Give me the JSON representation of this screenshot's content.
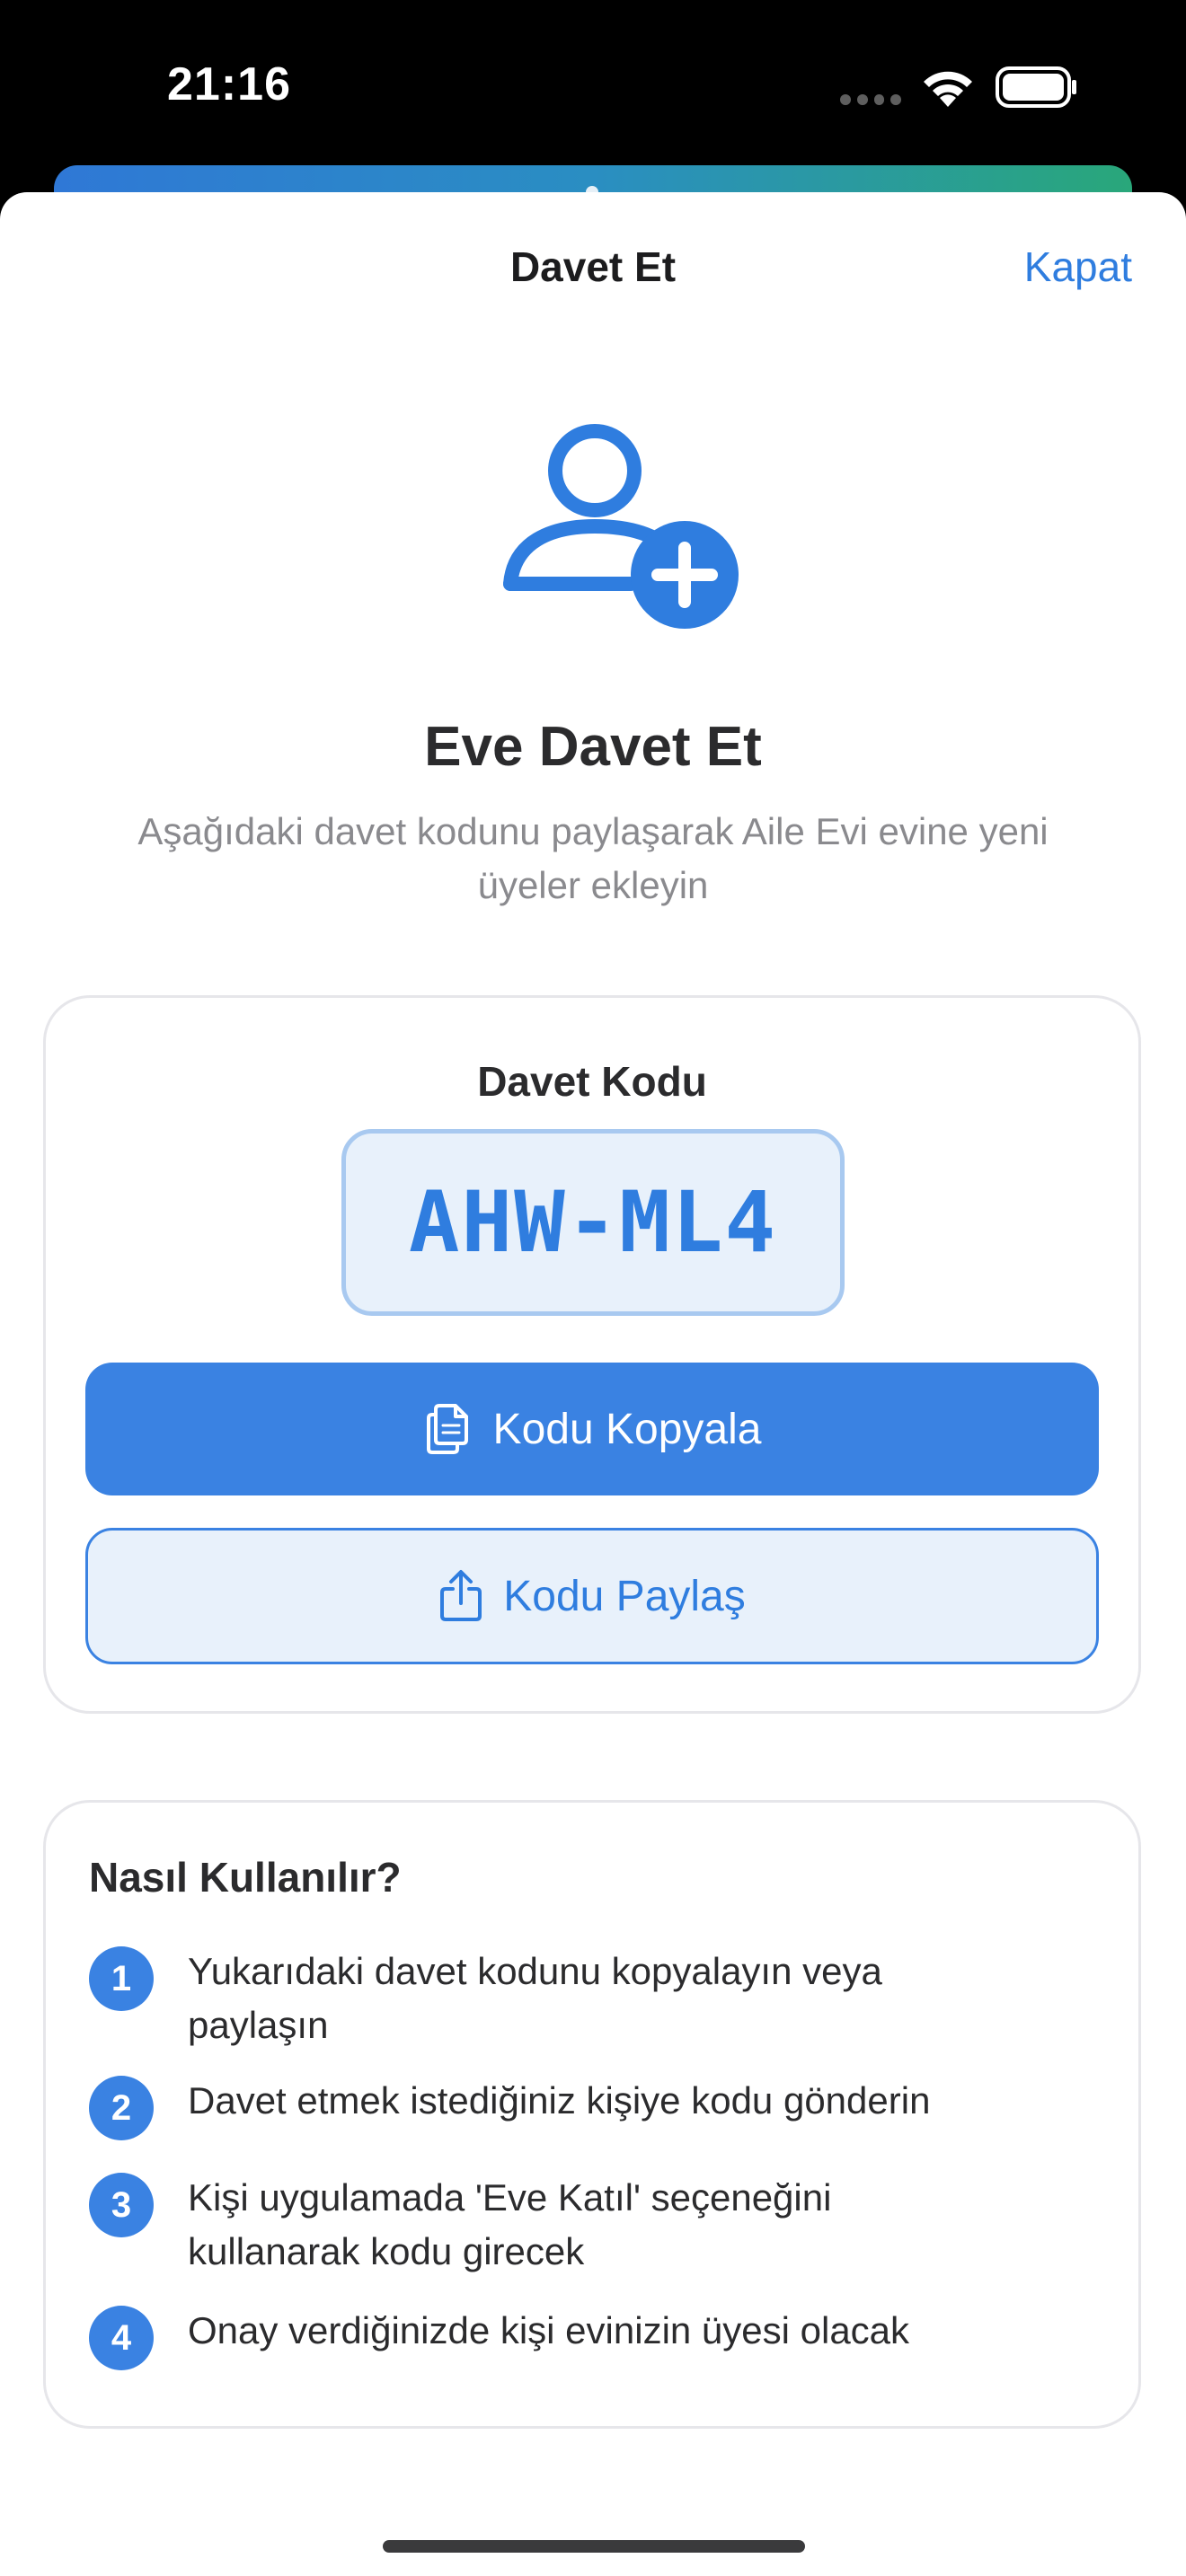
{
  "status_bar": {
    "time": "21:16",
    "wifi_icon": "wifi-icon",
    "battery_icon": "battery-icon"
  },
  "nav": {
    "title": "Davet Et",
    "close_label": "Kapat"
  },
  "header": {
    "icon": "person-add-icon",
    "title": "Eve Davet Et",
    "subtitle": "Aşağıdaki davet kodunu paylaşarak Aile Evi evine yeni üyeler ekleyin"
  },
  "code_card": {
    "label": "Davet Kodu",
    "code": "AHW-ML4",
    "copy_label": "Kodu Kopyala",
    "copy_icon": "copy-icon",
    "share_label": "Kodu Paylaş",
    "share_icon": "share-icon"
  },
  "howto": {
    "title": "Nasıl Kullanılır?",
    "steps": [
      {
        "number": "1",
        "text": "Yukarıdaki davet kodunu kopyalayın veya paylaşın"
      },
      {
        "number": "2",
        "text": "Davet etmek istediğiniz kişiye kodu gönderin"
      },
      {
        "number": "3",
        "text": "Kişi uygulamada 'Eve Katıl' seçeneğini kullanarak kodu girecek"
      },
      {
        "number": "4",
        "text": "Onay verdiğinizde kişi evinizin üyesi olacak"
      }
    ]
  },
  "colors": {
    "accent": "#3a82e2",
    "accent_light": "#e8f1fb",
    "text_primary": "#2b2b2d",
    "text_secondary": "#8a8a8e"
  }
}
